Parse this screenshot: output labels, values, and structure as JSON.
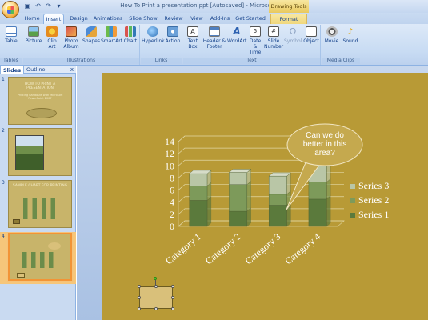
{
  "window": {
    "title": "How To Print a presentation.ppt [Autosaved] - Microsoft PowerPoint",
    "contextual_group": "Drawing Tools"
  },
  "tabs": [
    "Home",
    "Insert",
    "Design",
    "Animations",
    "Slide Show",
    "Review",
    "View",
    "Add-Ins",
    "Get Started",
    "Format"
  ],
  "active_tab": "Insert",
  "ribbon": {
    "groups": [
      {
        "label": "Tables",
        "buttons": [
          {
            "label": "Table",
            "icon": "table-icon"
          }
        ]
      },
      {
        "label": "Illustrations",
        "buttons": [
          {
            "label": "Picture",
            "icon": "picture-icon"
          },
          {
            "label": "Clip Art",
            "icon": "clip-art-icon"
          },
          {
            "label": "Photo Album",
            "icon": "photo-album-icon"
          },
          {
            "label": "Shapes",
            "icon": "shapes-icon"
          },
          {
            "label": "SmartArt",
            "icon": "smartart-icon"
          },
          {
            "label": "Chart",
            "icon": "chart-icon"
          }
        ]
      },
      {
        "label": "Links",
        "buttons": [
          {
            "label": "Hyperlink",
            "icon": "hyperlink-icon"
          },
          {
            "label": "Action",
            "icon": "action-icon"
          }
        ]
      },
      {
        "label": "Text",
        "buttons": [
          {
            "label": "Text Box",
            "icon": "text-box-icon"
          },
          {
            "label": "Header & Footer",
            "icon": "header-footer-icon"
          },
          {
            "label": "WordArt",
            "icon": "wordart-icon"
          },
          {
            "label": "Date & Time",
            "icon": "date-time-icon"
          },
          {
            "label": "Slide Number",
            "icon": "slide-number-icon"
          },
          {
            "label": "Symbol",
            "icon": "symbol-icon"
          },
          {
            "label": "Object",
            "icon": "object-icon"
          }
        ]
      },
      {
        "label": "Media Clips",
        "buttons": [
          {
            "label": "Movie",
            "icon": "movie-icon"
          },
          {
            "label": "Sound",
            "icon": "sound-icon"
          }
        ]
      }
    ]
  },
  "panel": {
    "tabs": [
      "Slides",
      "Outline"
    ],
    "close": "x",
    "thumbs": [
      {
        "num": "1",
        "title": "HOW TO PRINT A PRESENTATION",
        "subtitle": "Printing handouts with Microsoft PowerPoint 2007"
      },
      {
        "num": "2"
      },
      {
        "num": "3",
        "title": "SAMPLE CHART FOR PRINTING"
      },
      {
        "num": "4"
      }
    ]
  },
  "chart_data": {
    "type": "bar",
    "stacked": true,
    "three_d": true,
    "categories": [
      "Category 1",
      "Category 2",
      "Category 3",
      "Category 4"
    ],
    "series": [
      {
        "name": "Series 1",
        "values": [
          4.3,
          2.5,
          3.5,
          4.5
        ],
        "color": "#5b7a3c"
      },
      {
        "name": "Series 2",
        "values": [
          2.4,
          4.4,
          1.8,
          2.8
        ],
        "color": "#7d9a5a"
      },
      {
        "name": "Series 3",
        "values": [
          2,
          2,
          3,
          5
        ],
        "color": "#b9c6a6"
      }
    ],
    "yticks": [
      "0",
      "2",
      "4",
      "6",
      "8",
      "10",
      "12",
      "14"
    ],
    "ylim": [
      0,
      14
    ],
    "legend_position": "right",
    "gridlines": true
  },
  "callout": {
    "text_lines": [
      "Can we do",
      "better in this",
      "area?"
    ]
  },
  "colors": {
    "slide_background": "#b89a36",
    "office_blue": "#15428b",
    "drawing_tools": "#e9c95f"
  }
}
